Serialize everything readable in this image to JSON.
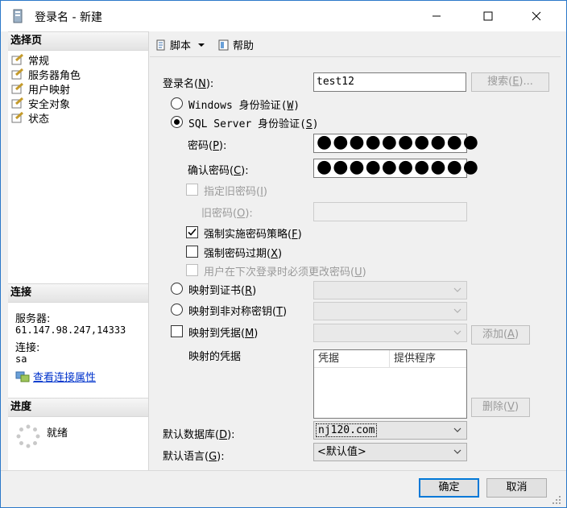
{
  "window": {
    "title": "登录名 - 新建"
  },
  "left": {
    "select_page_header": "选择页",
    "pages": [
      "常规",
      "服务器角色",
      "用户映射",
      "安全对象",
      "状态"
    ],
    "connection_header": "连接",
    "server_label": "服务器:",
    "server_value": "61.147.98.247,14333",
    "connection_label": "连接:",
    "connection_value": "sa",
    "view_conn_props": "查看连接属性",
    "progress_header": "进度",
    "progress_status": "就绪"
  },
  "toolbar": {
    "script_label": "脚本",
    "help_label": "帮助"
  },
  "form": {
    "login_name_label": "登录名(",
    "login_name_key": "N",
    "login_name_suffix": "):",
    "login_name_value": "test12",
    "search_label": "搜索(",
    "search_key": "E",
    "search_suffix": ")...",
    "windows_auth": "Windows 身份验证(",
    "windows_auth_key": "W",
    "sql_auth": "SQL Server 身份验证(",
    "sql_auth_key": "S",
    "password_label": "密码(",
    "password_key": "P",
    "password_suffix": "):",
    "password_value": "●●●●●●●●●●",
    "confirm_label": "确认密码(",
    "confirm_key": "C",
    "confirm_suffix": "):",
    "confirm_value": "●●●●●●●●●●",
    "specify_old_pwd": "指定旧密码(",
    "specify_old_pwd_key": "I",
    "old_pwd_label": "旧密码(",
    "old_pwd_key": "O",
    "old_pwd_suffix": "):",
    "enforce_policy": "强制实施密码策略(",
    "enforce_policy_key": "F",
    "enforce_expiration": "强制密码过期(",
    "enforce_expiration_key": "X",
    "must_change": "用户在下次登录时必须更改密码(",
    "must_change_key": "U",
    "map_cert": "映射到证书(",
    "map_cert_key": "R",
    "map_asym": "映射到非对称密钥(",
    "map_asym_key": "T",
    "map_cred": "映射到凭据(",
    "map_cred_key": "M",
    "add_label": "添加(",
    "add_key": "A",
    "mapped_creds_label": "映射的凭据",
    "cred_col1": "凭据",
    "cred_col2": "提供程序",
    "remove_label": "删除(",
    "remove_key": "V",
    "default_db_label": "默认数据库(",
    "default_db_key": "D",
    "default_db_suffix": "):",
    "default_db_value": "nj120.com",
    "default_lang_label": "默认语言(",
    "default_lang_key": "G",
    "default_lang_suffix": "):",
    "default_lang_value": "<默认值>",
    "close_paren": ")"
  },
  "footer": {
    "ok_label": "确定",
    "cancel_label": "取消"
  },
  "state": {
    "sql_auth_selected": true,
    "enforce_policy_checked": true,
    "enforce_expiration_checked": false
  },
  "colors": {
    "link": "#0033cc",
    "focus": "#0078d7",
    "disabled": "#9a9a9a"
  }
}
